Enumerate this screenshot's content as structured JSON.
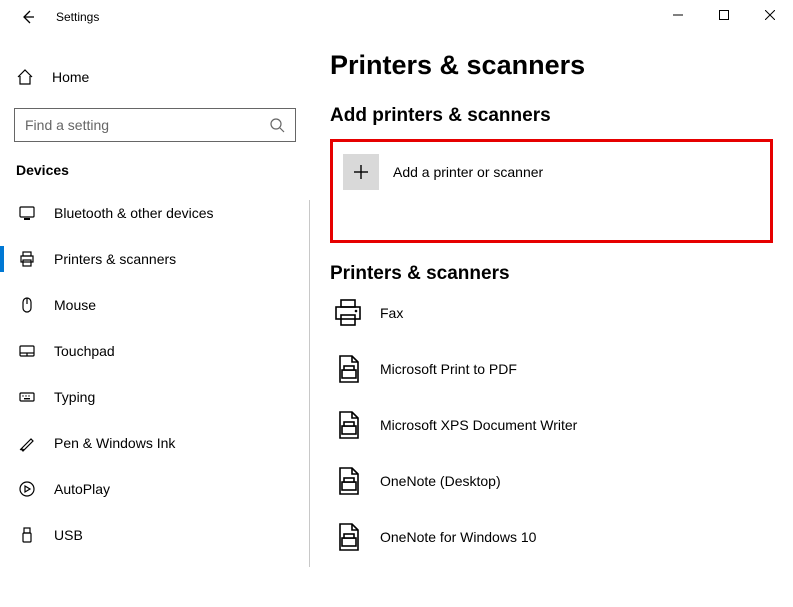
{
  "app_title": "Settings",
  "home_label": "Home",
  "search_placeholder": "Find a setting",
  "devices_label": "Devices",
  "nav": [
    {
      "label": "Bluetooth & other devices",
      "icon": "bluetooth"
    },
    {
      "label": "Printers & scanners",
      "icon": "printer",
      "active": true
    },
    {
      "label": "Mouse",
      "icon": "mouse"
    },
    {
      "label": "Touchpad",
      "icon": "touchpad"
    },
    {
      "label": "Typing",
      "icon": "typing"
    },
    {
      "label": "Pen & Windows Ink",
      "icon": "pen"
    },
    {
      "label": "AutoPlay",
      "icon": "autoplay"
    },
    {
      "label": "USB",
      "icon": "usb"
    }
  ],
  "page_title": "Printers & scanners",
  "add_section_title": "Add printers & scanners",
  "add_button_label": "Add a printer or scanner",
  "list_section_title": "Printers & scanners",
  "printers": [
    {
      "label": "Fax",
      "icon": "fax"
    },
    {
      "label": "Microsoft Print to PDF",
      "icon": "doc-printer"
    },
    {
      "label": "Microsoft XPS Document Writer",
      "icon": "doc-printer"
    },
    {
      "label": "OneNote (Desktop)",
      "icon": "doc-printer"
    },
    {
      "label": "OneNote for Windows 10",
      "icon": "doc-printer"
    }
  ]
}
